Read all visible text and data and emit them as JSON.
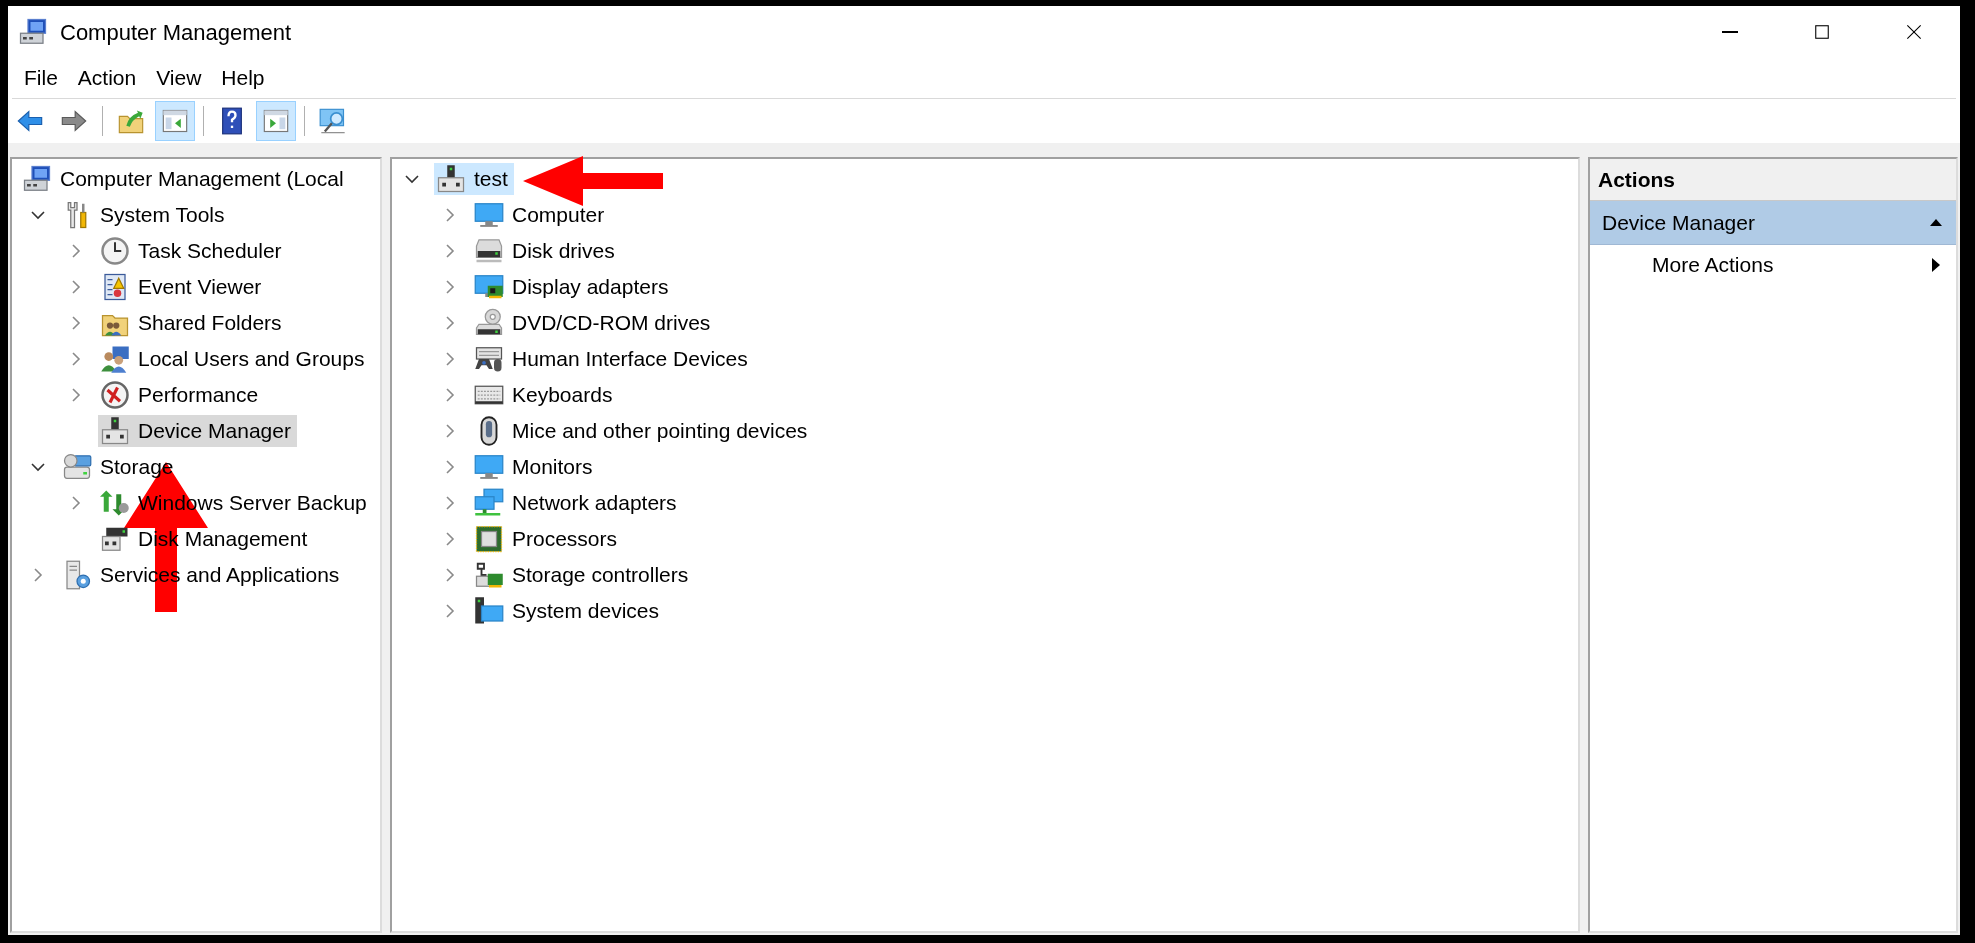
{
  "window": {
    "title": "Computer Management"
  },
  "menu": [
    "File",
    "Action",
    "View",
    "Help"
  ],
  "toolbar": [
    {
      "kind": "back",
      "disabled": false
    },
    {
      "kind": "forward",
      "disabled": true
    },
    {
      "kind": "separator"
    },
    {
      "kind": "up",
      "pressed": false
    },
    {
      "kind": "console_tree",
      "pressed": true
    },
    {
      "kind": "separator"
    },
    {
      "kind": "help",
      "pressed": false
    },
    {
      "kind": "action_pane",
      "pressed": true
    },
    {
      "kind": "separator"
    },
    {
      "kind": "connect",
      "pressed": false
    }
  ],
  "left_tree": [
    {
      "label": "Computer Management (Local",
      "selected": false,
      "children": [
        {
          "label": "System Tools",
          "expanded": true,
          "selected": false,
          "children": [
            {
              "label": "Task Scheduler",
              "expanded": false,
              "selected": false
            },
            {
              "label": "Event Viewer",
              "expanded": false,
              "selected": false
            },
            {
              "label": "Shared Folders",
              "expanded": false,
              "selected": false
            },
            {
              "label": "Local Users and Groups",
              "expanded": false,
              "selected": false
            },
            {
              "label": "Performance",
              "expanded": false,
              "selected": false
            },
            {
              "label": "Device Manager",
              "selected": true
            }
          ]
        },
        {
          "label": "Storage",
          "expanded": true,
          "selected": false,
          "children": [
            {
              "label": "Windows Server Backup",
              "expanded": false,
              "selected": false
            },
            {
              "label": "Disk Management",
              "selected": false
            }
          ]
        },
        {
          "label": "Services and Applications",
          "expanded": false,
          "selected": false
        }
      ]
    }
  ],
  "device_tree": [
    {
      "label": "test",
      "expanded": true,
      "selected": true,
      "children": [
        {
          "label": "Computer",
          "expanded": false,
          "selected": false
        },
        {
          "label": "Disk drives",
          "expanded": false,
          "selected": false
        },
        {
          "label": "Display adapters",
          "expanded": false,
          "selected": false
        },
        {
          "label": "DVD/CD-ROM drives",
          "expanded": false,
          "selected": false
        },
        {
          "label": "Human Interface Devices",
          "expanded": false,
          "selected": false
        },
        {
          "label": "Keyboards",
          "expanded": false,
          "selected": false
        },
        {
          "label": "Mice and other pointing devices",
          "expanded": false,
          "selected": false
        },
        {
          "label": "Monitors",
          "expanded": false,
          "selected": false
        },
        {
          "label": "Network adapters",
          "expanded": false,
          "selected": false
        },
        {
          "label": "Processors",
          "expanded": false,
          "selected": false
        },
        {
          "label": "Storage controllers",
          "expanded": false,
          "selected": false
        },
        {
          "label": "System devices",
          "expanded": false,
          "selected": false
        }
      ]
    }
  ],
  "actions": {
    "title": "Actions",
    "sections": [
      {
        "label": "Device Manager",
        "expanded": true,
        "items": [
          {
            "label": "More Actions"
          }
        ]
      }
    ]
  },
  "annotations": [
    {
      "kind": "arrow_left"
    },
    {
      "kind": "arrow_up"
    }
  ]
}
